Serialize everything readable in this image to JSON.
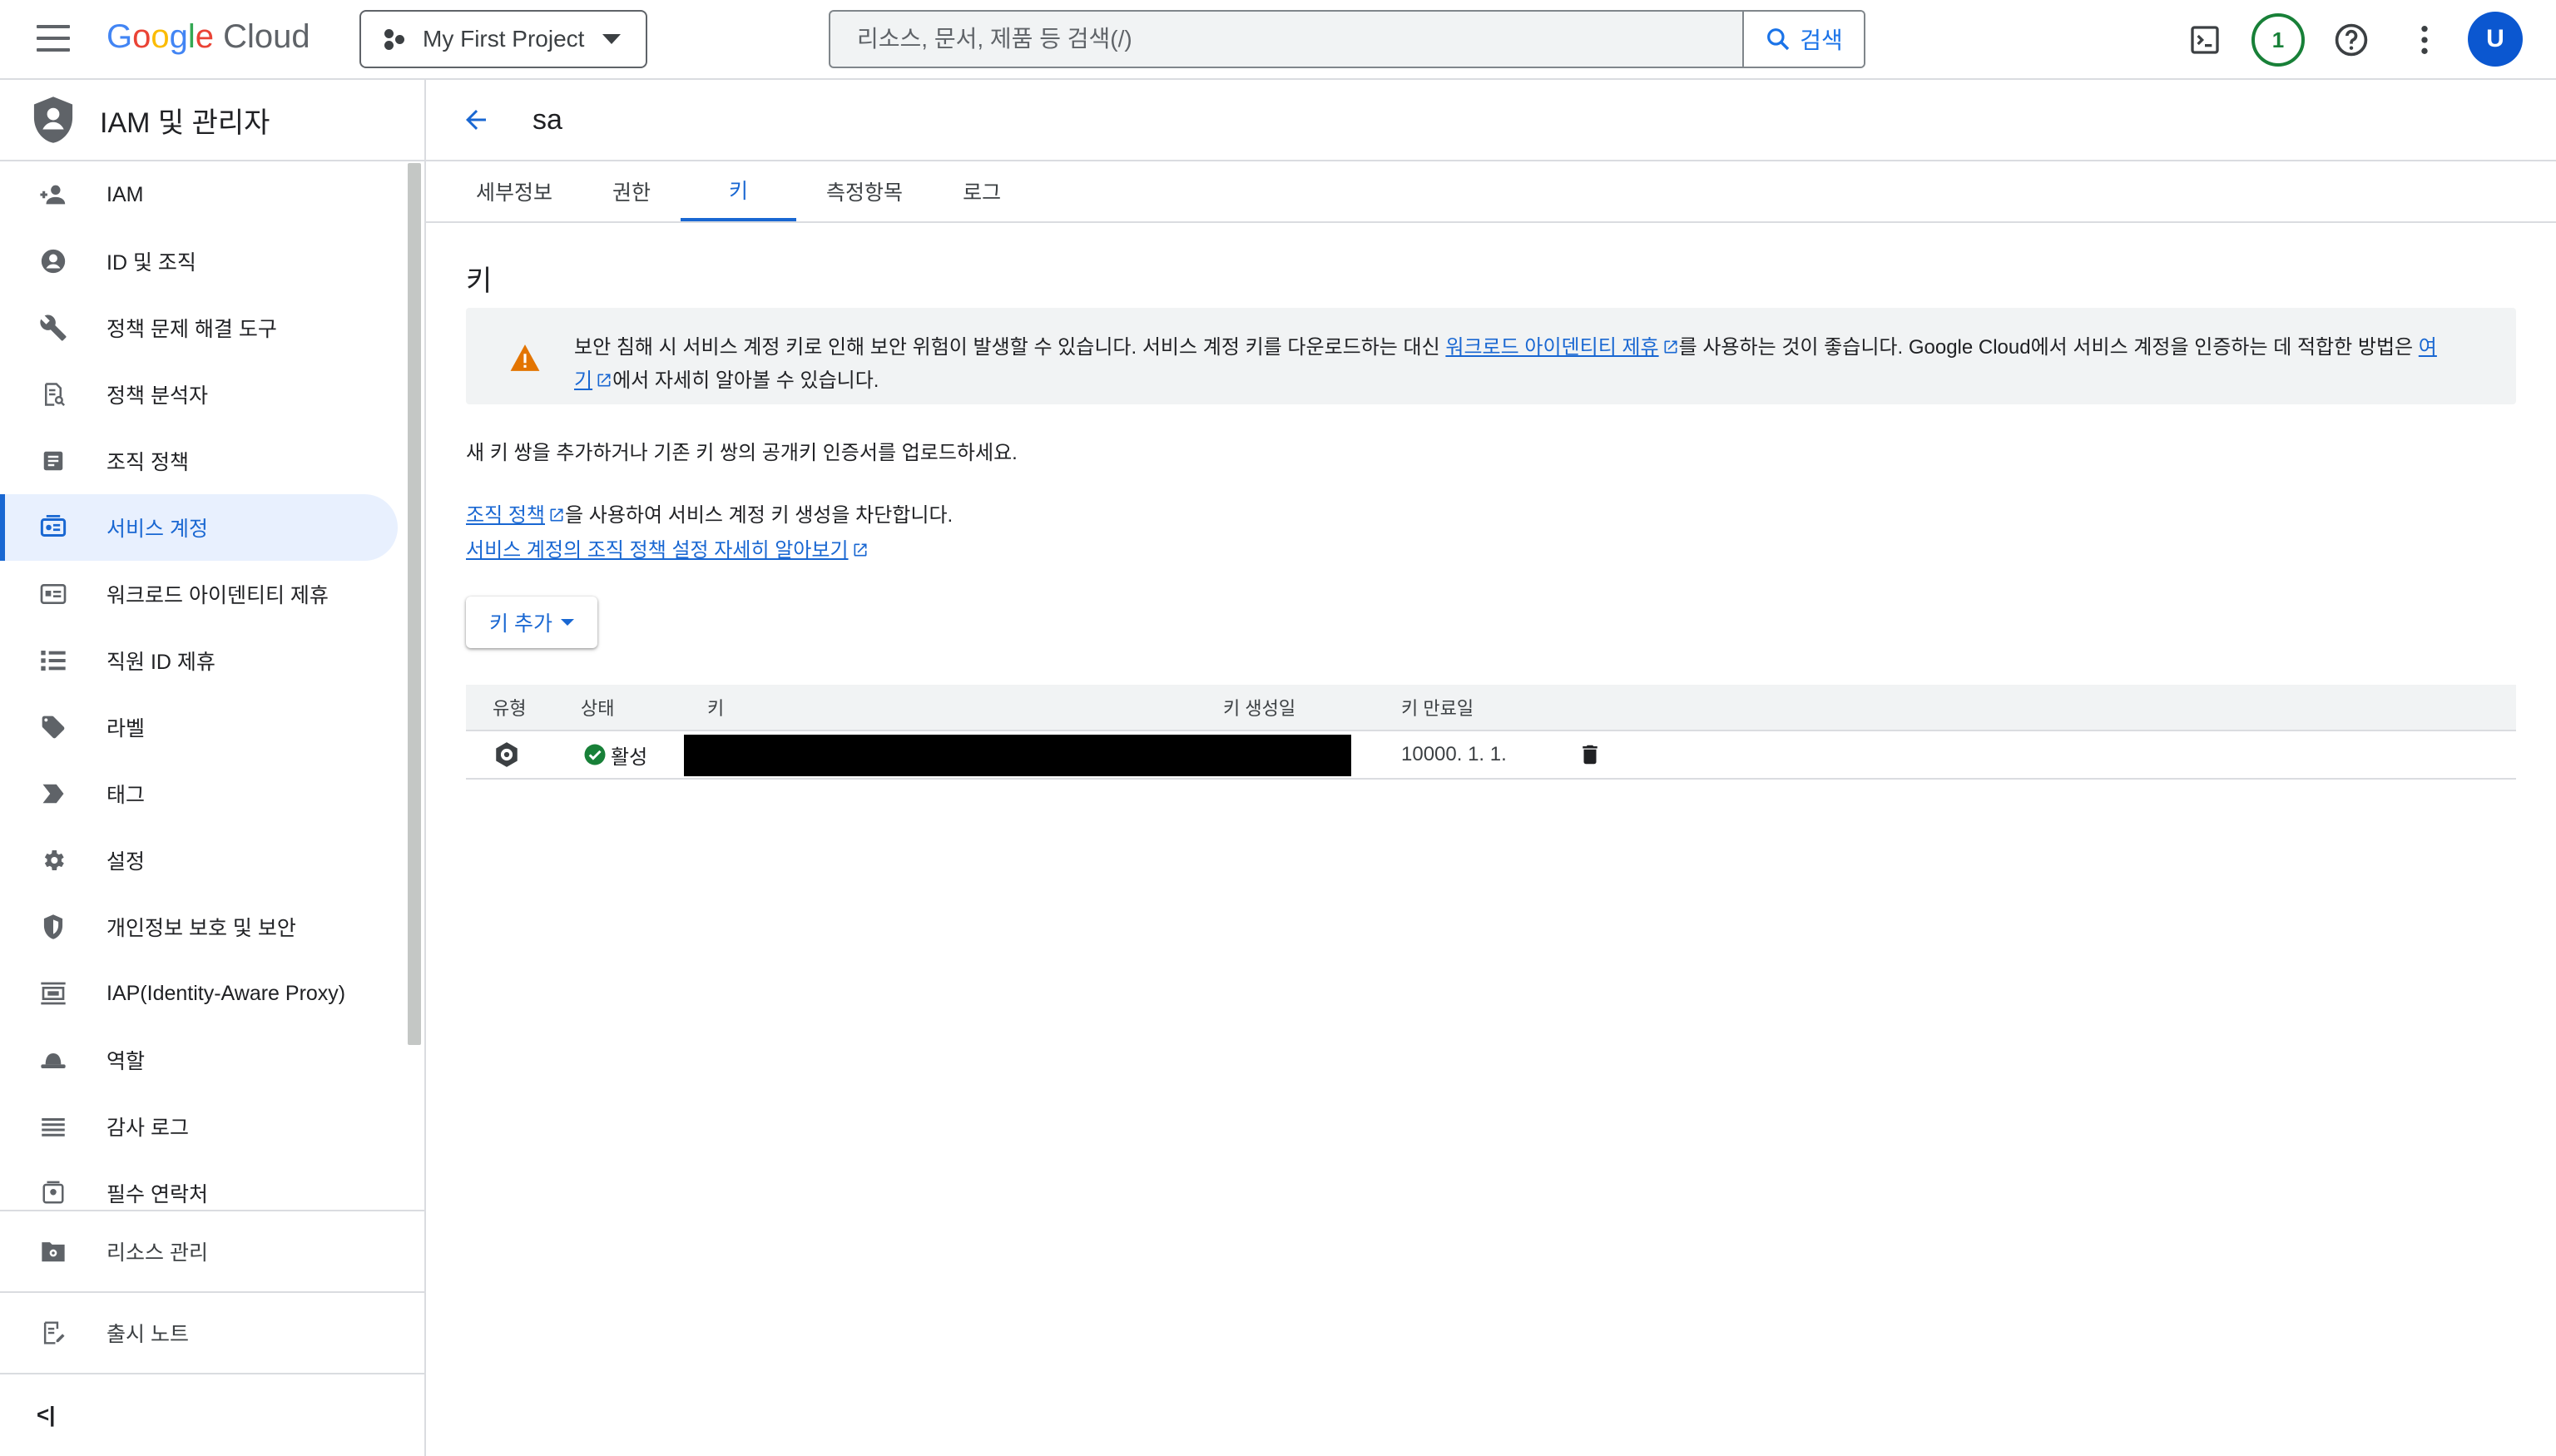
{
  "topbar": {
    "logo_google": "Google",
    "logo_cloud": "Cloud",
    "project_name": "My First Project",
    "search_placeholder": "리소스, 문서, 제품 등 검색(/)",
    "search_button": "검색",
    "notification_count": "1",
    "avatar_letter": "U"
  },
  "sidebar": {
    "title": "IAM 및 관리자",
    "items": [
      {
        "label": "IAM",
        "icon": "person-add-icon"
      },
      {
        "label": "ID 및 조직",
        "icon": "account-circle-icon"
      },
      {
        "label": "정책 문제 해결 도구",
        "icon": "wrench-icon"
      },
      {
        "label": "정책 분석자",
        "icon": "policy-analyzer-icon"
      },
      {
        "label": "조직 정책",
        "icon": "document-icon"
      },
      {
        "label": "서비스 계정",
        "icon": "service-account-icon"
      },
      {
        "label": "워크로드 아이덴티티 제휴",
        "icon": "id-card-icon"
      },
      {
        "label": "직원 ID 제휴",
        "icon": "list-icon"
      },
      {
        "label": "라벨",
        "icon": "label-icon"
      },
      {
        "label": "태그",
        "icon": "tag-icon"
      },
      {
        "label": "설정",
        "icon": "gear-icon"
      },
      {
        "label": "개인정보 보호 및 보안",
        "icon": "shield-icon"
      },
      {
        "label": "IAP(Identity-Aware Proxy)",
        "icon": "proxy-icon"
      },
      {
        "label": "역할",
        "icon": "hat-icon"
      },
      {
        "label": "감사 로그",
        "icon": "lines-icon"
      },
      {
        "label": "필수 연락처",
        "icon": "contact-icon"
      }
    ],
    "resource_manager": "리소스 관리",
    "release_notes": "출시 노트",
    "collapse_glyph": "<|"
  },
  "page": {
    "title": "sa",
    "tabs": [
      "세부정보",
      "권한",
      "키",
      "측정항목",
      "로그"
    ],
    "section_title": "키",
    "warning": {
      "part1": "보안 침해 시 서비스 계정 키로 인해 보안 위험이 발생할 수 있습니다. 서비스 계정 키를 다운로드하는 대신 ",
      "link1": "워크로드 아이덴티티 제휴",
      "part2": "를 사용하는 것이 좋습니다. Google Cloud에서 서비스 계정을 인증하는 데 적합한 방법은 ",
      "link2a": "여",
      "link2b": "기",
      "part3": "에서 자세히 알아볼 수 있습니다."
    },
    "intro": "새 키 쌍을 추가하거나 기존 키 쌍의 공개키 인증서를 업로드하세요.",
    "org_policy_link": "조직 정책",
    "org_policy_text": "을 사용하여 서비스 계정 키 생성을 차단합니다.",
    "learn_more_link": "서비스 계정의 조직 정책 설정 자세히 알아보기",
    "add_key_button": "키 추가"
  },
  "table": {
    "headers": {
      "type": "유형",
      "status": "상태",
      "key": "키",
      "created": "키 생성일",
      "expires": "키 만료일"
    },
    "rows": [
      {
        "status": "활성",
        "created": "",
        "expires": "10000. 1. 1."
      }
    ]
  }
}
